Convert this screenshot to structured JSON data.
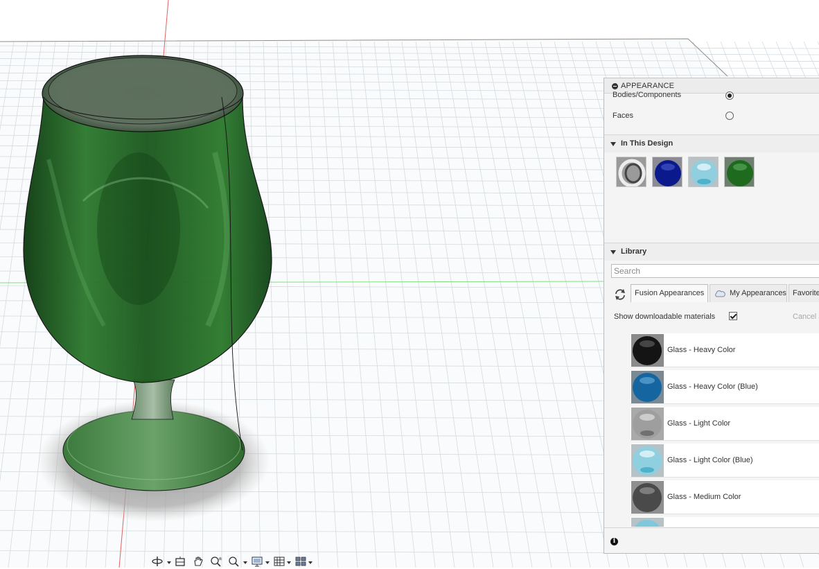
{
  "appearance_panel": {
    "title": "APPEARANCE",
    "apply_to": {
      "bodies_label": "Bodies/Components",
      "faces_label": "Faces",
      "selected": "Bodies/Components"
    },
    "in_this_design": {
      "header": "In This Design",
      "swatches": [
        {
          "name": "chrome-ring-swatch",
          "color": "#8c8c8c"
        },
        {
          "name": "blue-glass-swatch",
          "color": "#0a1a8c"
        },
        {
          "name": "light-blue-glass-swatch",
          "color": "#8fcfe0"
        },
        {
          "name": "green-glass-swatch",
          "color": "#1e6a1e"
        }
      ]
    },
    "library": {
      "header": "Library",
      "search_placeholder": "Search",
      "tabs": [
        {
          "label": "Fusion Appearances",
          "active": true
        },
        {
          "label": "My Appearances",
          "active": false
        },
        {
          "label": "Favorite",
          "active": false
        }
      ],
      "show_downloadable_label": "Show downloadable materials",
      "show_downloadable_checked": true,
      "cancel_label": "Cancel a",
      "materials": [
        {
          "label": "Glass - Heavy Color",
          "color": "#141414"
        },
        {
          "label": "Glass - Heavy Color (Blue)",
          "color": "#1565a0"
        },
        {
          "label": "Glass - Light Color",
          "color": "#9e9e9e"
        },
        {
          "label": "Glass - Light Color (Blue)",
          "color": "#8fcfe0"
        },
        {
          "label": "Glass - Medium Color",
          "color": "#4a4a4a"
        }
      ]
    }
  },
  "viewport": {
    "model": "glass-goblet",
    "model_color": "#2d6e2d",
    "grid_color": "#c9d2d8"
  },
  "navbar": {
    "tools": [
      "orbit-icon",
      "look-at-icon",
      "pan-icon",
      "zoom-icon",
      "zoom-window-icon",
      "display-settings-icon",
      "grid-settings-icon",
      "viewports-icon"
    ]
  }
}
